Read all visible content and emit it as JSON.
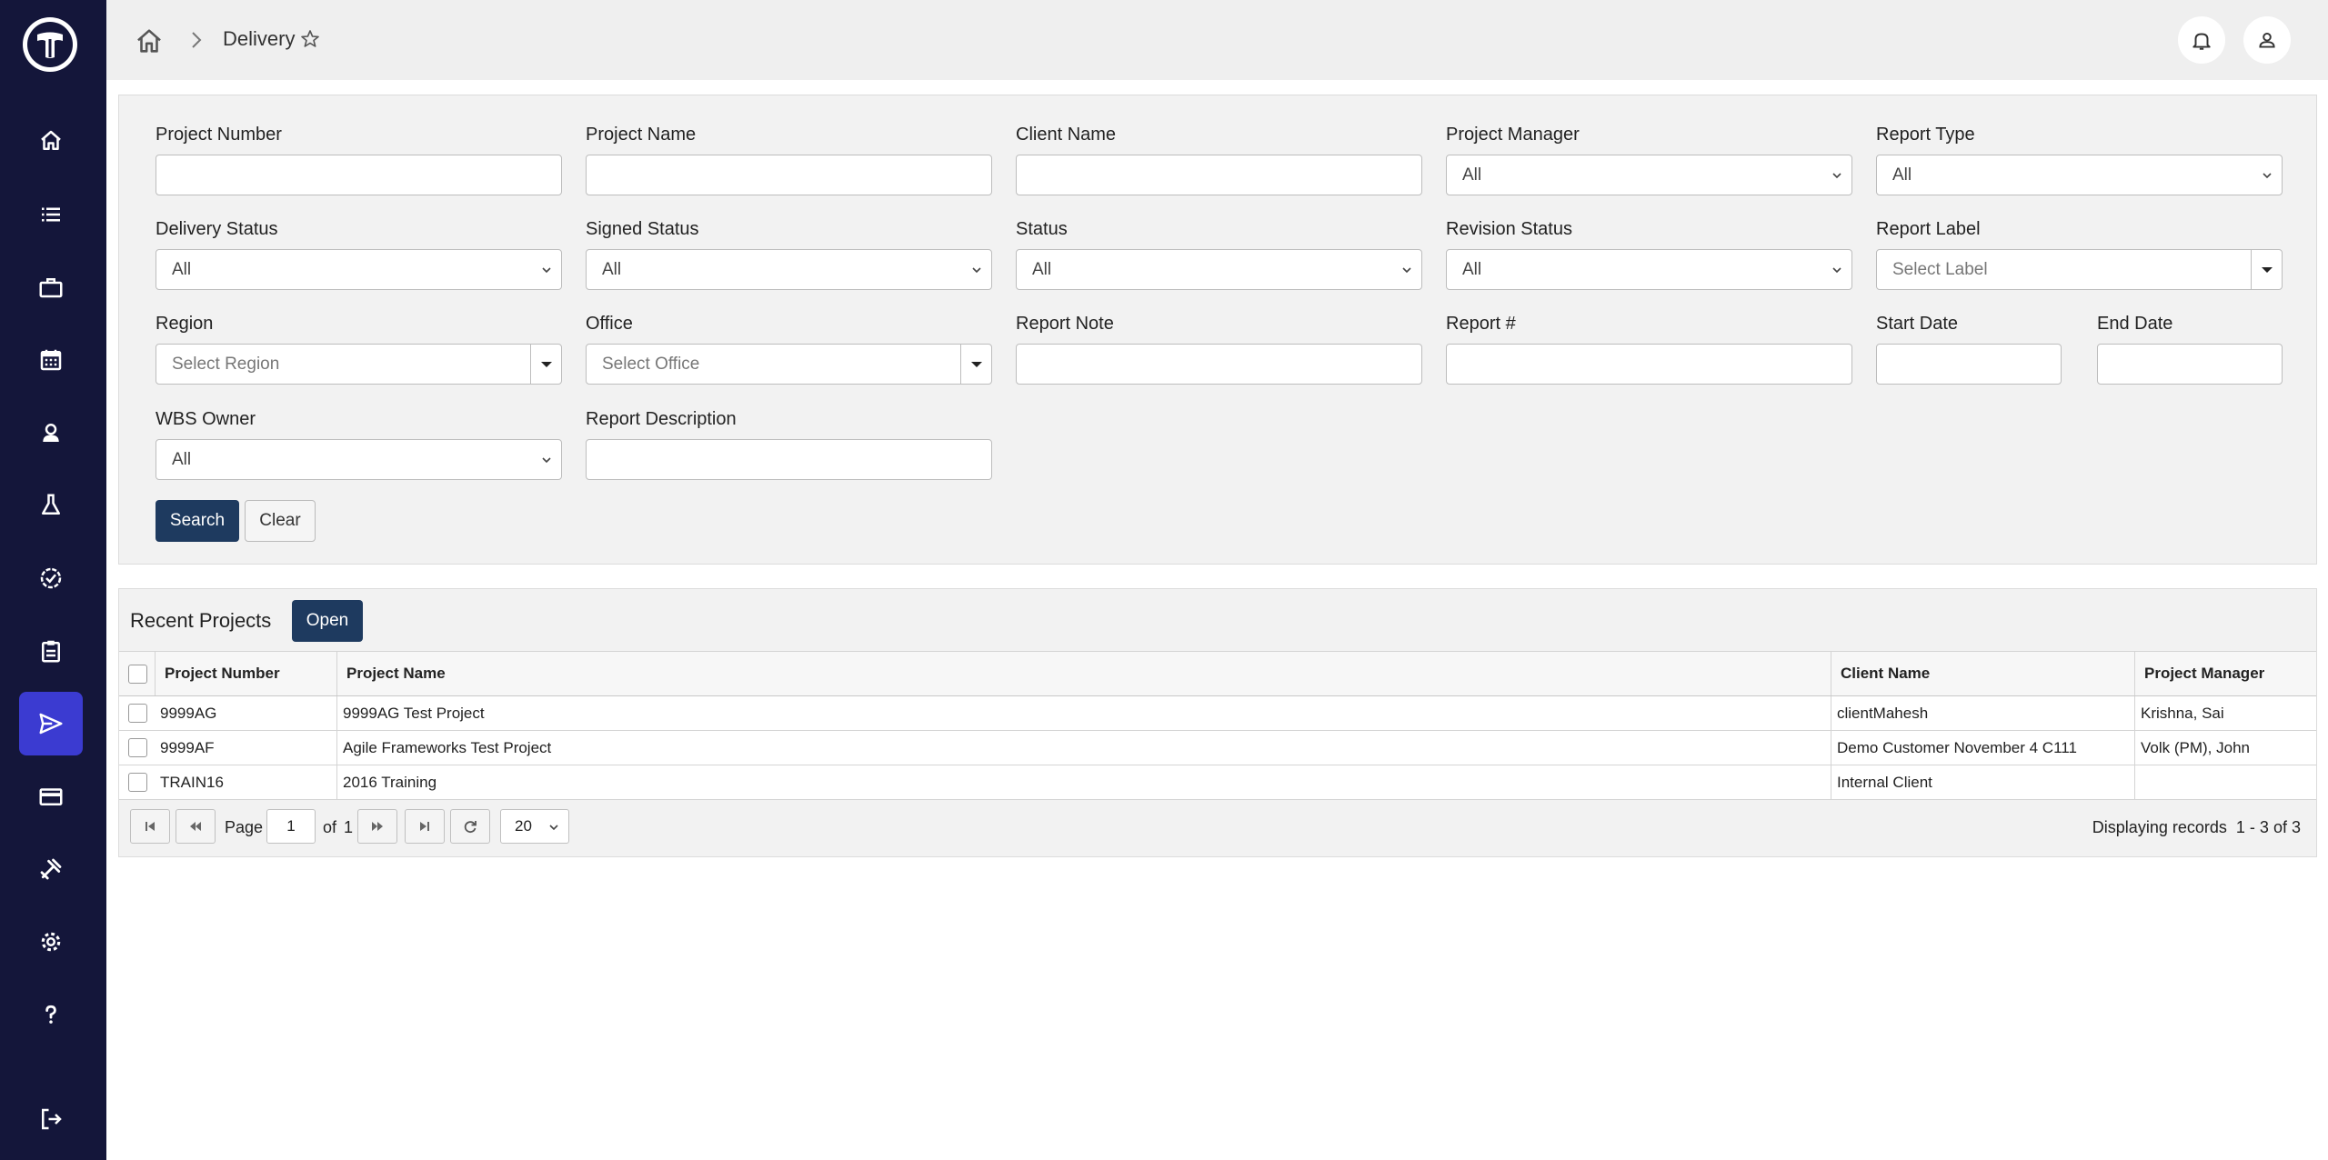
{
  "app": {
    "logo": "company-logo"
  },
  "sidebar": {
    "items": [
      {
        "name": "home",
        "icon": "home-icon"
      },
      {
        "name": "list",
        "icon": "list-icon"
      },
      {
        "name": "projects",
        "icon": "briefcase-icon"
      },
      {
        "name": "calendar",
        "icon": "calendar-icon"
      },
      {
        "name": "people",
        "icon": "person-icon"
      },
      {
        "name": "lab",
        "icon": "flask-icon"
      },
      {
        "name": "approvals",
        "icon": "badge-check-icon"
      },
      {
        "name": "reports",
        "icon": "clipboard-icon"
      },
      {
        "name": "delivery",
        "icon": "send-icon",
        "active": true
      },
      {
        "name": "billing",
        "icon": "credit-card-icon"
      },
      {
        "name": "tools",
        "icon": "tools-icon"
      },
      {
        "name": "settings",
        "icon": "gear-icon"
      },
      {
        "name": "help",
        "icon": "question-icon"
      },
      {
        "name": "logout",
        "icon": "logout-icon"
      }
    ],
    "active_color": "#3b3bd1",
    "background": "#14163a"
  },
  "header": {
    "title": "Delivery",
    "favorite": false
  },
  "filters": {
    "project_number": {
      "label": "Project Number",
      "value": ""
    },
    "project_name": {
      "label": "Project Name",
      "value": ""
    },
    "client_name": {
      "label": "Client Name",
      "value": ""
    },
    "project_manager": {
      "label": "Project Manager",
      "value": "All"
    },
    "report_type": {
      "label": "Report Type",
      "value": "All"
    },
    "delivery_status": {
      "label": "Delivery Status",
      "value": "All"
    },
    "signed_status": {
      "label": "Signed Status",
      "value": "All"
    },
    "status": {
      "label": "Status",
      "value": "All"
    },
    "revision_status": {
      "label": "Revision Status",
      "value": "All"
    },
    "report_label": {
      "label": "Report Label",
      "placeholder": "Select Label"
    },
    "region": {
      "label": "Region",
      "placeholder": "Select Region"
    },
    "office": {
      "label": "Office",
      "placeholder": "Select Office"
    },
    "report_note": {
      "label": "Report Note",
      "value": ""
    },
    "report_num": {
      "label": "Report #",
      "value": ""
    },
    "start_date": {
      "label": "Start Date",
      "value": ""
    },
    "end_date": {
      "label": "End Date",
      "value": ""
    },
    "wbs_owner": {
      "label": "WBS Owner",
      "value": "All"
    },
    "report_description": {
      "label": "Report Description",
      "value": ""
    },
    "search_label": "Search",
    "clear_label": "Clear"
  },
  "recent": {
    "title": "Recent Projects",
    "open_label": "Open",
    "columns": [
      "Project Number",
      "Project Name",
      "Client Name",
      "Project Manager"
    ],
    "rows": [
      {
        "number": "9999AG",
        "name": "9999AG Test Project",
        "client": "clientMahesh",
        "manager": "Krishna, Sai"
      },
      {
        "number": "9999AF",
        "name": "Agile Frameworks Test Project",
        "client": "Demo Customer November 4 C111",
        "manager": "Volk (PM), John"
      },
      {
        "number": "TRAIN16",
        "name": "2016 Training",
        "client": "Internal Client",
        "manager": ""
      }
    ]
  },
  "pager": {
    "page_label": "Page",
    "page": "1",
    "of_label": "of",
    "total_pages": "1",
    "page_size": "20",
    "display_label": "Displaying records",
    "range_start": "1",
    "dash": "-",
    "range_end": "3",
    "of_total_label": "of",
    "total": "3"
  }
}
